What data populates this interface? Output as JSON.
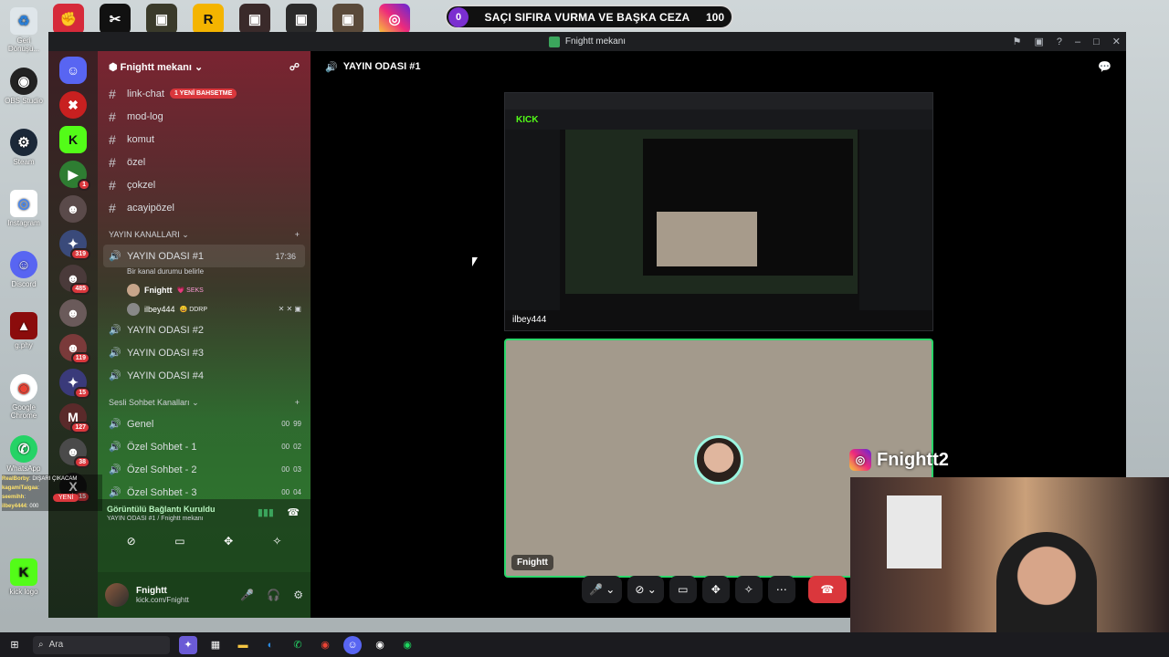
{
  "goal_bar": {
    "count": "0",
    "text": "SAÇI SIFIRA VURMA VE BAŞKA CEZA",
    "target": "100"
  },
  "desktop_icons": [
    "Geri Dönüşü...",
    "OBS Studio",
    "Steam",
    "Instagram",
    "Discord",
    "g.phy",
    "Google Chrome",
    "WhatsApp",
    "kick logo"
  ],
  "window": {
    "title": "Fnightt mekanı"
  },
  "server": {
    "name": "Fnightt mekanı",
    "text_channels": [
      {
        "name": "link-chat",
        "mention": "1 YENİ BAHSETME"
      },
      {
        "name": "mod-log"
      },
      {
        "name": "komut"
      },
      {
        "name": "özel"
      },
      {
        "name": "çokzel"
      },
      {
        "name": "acayipözel"
      }
    ],
    "category_streams": "YAYIN KANALLARI",
    "active_channel": {
      "name": "YAYIN ODASI #1",
      "time": "17:36",
      "status": "Bir kanal durumu belirle"
    },
    "members": [
      {
        "name": "Fnightt",
        "tag": "💗 SEKS"
      },
      {
        "name": "ilbey444",
        "tag": "😄 DDRP"
      }
    ],
    "stream_channels": [
      "YAYIN ODASI #2",
      "YAYIN ODASI #3",
      "YAYIN ODASI #4"
    ],
    "category_voice": "Sesli Sohbet Kanalları",
    "voice_channels": [
      {
        "name": "Genel",
        "a": "00",
        "b": "99"
      },
      {
        "name": "Özel Sohbet - 1",
        "a": "00",
        "b": "02"
      },
      {
        "name": "Özel Sohbet - 2",
        "a": "00",
        "b": "03"
      },
      {
        "name": "Özel Sohbet - 3",
        "a": "00",
        "b": "04"
      }
    ]
  },
  "rtc": {
    "status": "Görüntülü Bağlantı Kuruldu",
    "location": "YAYIN ODASI #1 / Fnightt mekanı"
  },
  "user": {
    "name": "Fnightt",
    "status": "kick.com/Fnightt"
  },
  "call": {
    "header": "YAYIN ODASI #1",
    "stream_owner": "ilbey444",
    "tile_name": "Fnightt"
  },
  "overlay": {
    "instagram_handle": "Fnightt2",
    "chat_lines": [
      {
        "user": "RealBorby",
        "text": "DIŞARI ÇIKACAM"
      },
      {
        "user": "kagamiTaigaa",
        "text": ""
      },
      {
        "user": "seemihh",
        "text": ""
      },
      {
        "user": "ilbey4444",
        "text": "000"
      }
    ],
    "new_badge": "YENİ"
  },
  "taskbar": {
    "search": "Ara"
  },
  "colors": {
    "discord_green": "#3ba55c",
    "mention_red": "#da373c",
    "kick_green": "#53fc18"
  }
}
